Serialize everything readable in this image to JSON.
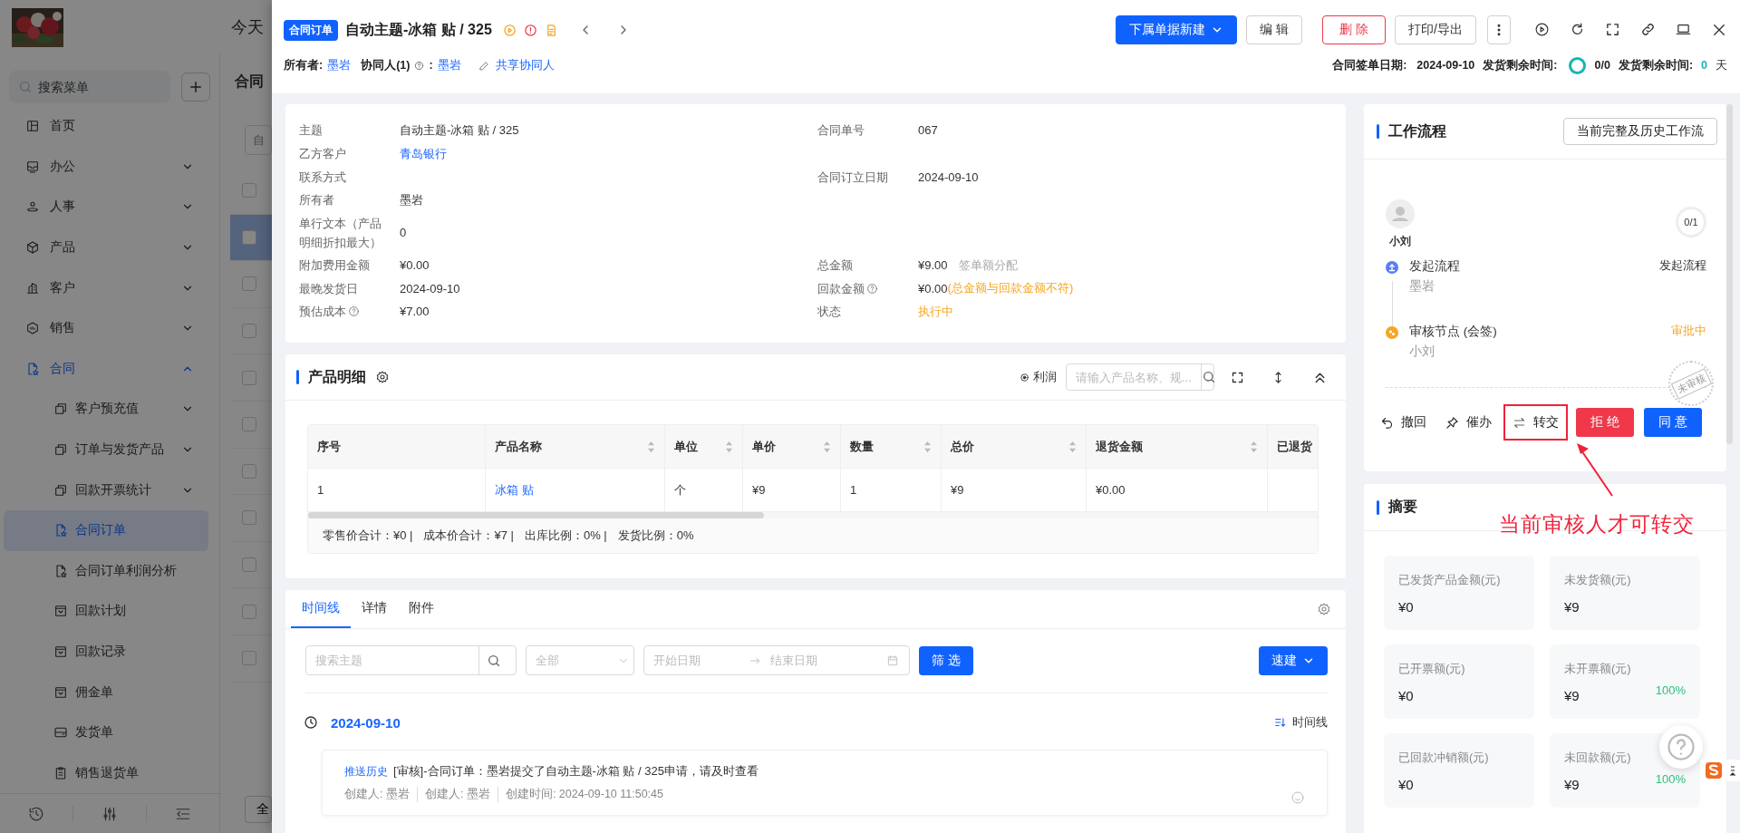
{
  "background_app": {
    "header_text": "今天",
    "sidebar": {
      "search_placeholder": "搜索菜单",
      "items": [
        {
          "label": "首页",
          "kind": "link",
          "selected": false
        },
        {
          "label": "办公",
          "kind": "group",
          "expanded": false,
          "selected": false
        },
        {
          "label": "人事",
          "kind": "group",
          "expanded": false,
          "selected": false
        },
        {
          "label": "产品",
          "kind": "group",
          "expanded": false,
          "selected": false
        },
        {
          "label": "客户",
          "kind": "group",
          "expanded": false,
          "selected": false
        },
        {
          "label": "销售",
          "kind": "group",
          "expanded": false,
          "selected": false
        },
        {
          "label": "合同",
          "kind": "group",
          "expanded": true,
          "selected": true,
          "children": [
            {
              "label": "客户预充值",
              "kind": "group",
              "expanded": false,
              "selected": false
            },
            {
              "label": "订单与发货产品",
              "kind": "group",
              "expanded": false,
              "selected": false
            },
            {
              "label": "回款开票统计",
              "kind": "group",
              "expanded": false,
              "selected": false
            },
            {
              "label": "合同订单",
              "kind": "link",
              "selected": true
            },
            {
              "label": "合同订单利润分析",
              "kind": "link",
              "selected": false
            },
            {
              "label": "回款计划",
              "kind": "link",
              "selected": false
            },
            {
              "label": "回款记录",
              "kind": "link",
              "selected": false
            },
            {
              "label": "佣金单",
              "kind": "link",
              "selected": false
            },
            {
              "label": "发货单",
              "kind": "link",
              "selected": false
            },
            {
              "label": "销售退货单",
              "kind": "link",
              "selected": false
            }
          ]
        }
      ]
    },
    "list": {
      "title": "合同",
      "filter_placeholder": "自",
      "rows": [
        {
          "checked": false,
          "selected": false
        },
        {
          "checked": false,
          "selected": true
        },
        {
          "checked": false,
          "selected": false
        },
        {
          "checked": false,
          "selected": false
        },
        {
          "checked": false,
          "selected": false
        },
        {
          "checked": false,
          "selected": false
        },
        {
          "checked": false,
          "selected": false
        },
        {
          "checked": false,
          "selected": false
        },
        {
          "checked": false,
          "selected": false
        },
        {
          "checked": false,
          "selected": false
        },
        {
          "checked": false,
          "selected": false
        }
      ],
      "footer_button": "全"
    }
  },
  "drawer": {
    "header": {
      "tag": "合同订单",
      "title": "自动主题-冰箱 贴 / 325",
      "actions": [
        {
          "label": "下属单据新建",
          "kind": "primary-dropdown"
        },
        {
          "label": "编 辑",
          "kind": "default"
        },
        {
          "label": "删 除",
          "kind": "danger"
        },
        {
          "label": "打印/导出",
          "kind": "default"
        }
      ],
      "owner": {
        "label": "所有者:",
        "value": "墨岩"
      },
      "collaborators": {
        "label": "协同人(1)",
        "separator": ":",
        "value": "墨岩"
      },
      "share_link": "共享协同人",
      "sign_date": {
        "label": "合同签单日期:",
        "value": "2024-09-10"
      },
      "delivery_progress": {
        "label": "发货剩余时间:",
        "value": "0/0"
      },
      "remaining": {
        "label": "发货剩余时间:",
        "value": "0",
        "unit": "天"
      }
    },
    "details": [
      {
        "left": {
          "label": "主题",
          "value": "自动主题-冰箱 贴 / 325",
          "kind": "text",
          "help": false
        },
        "right": {
          "label": "合同单号",
          "value": "067",
          "kind": "text",
          "help": false
        }
      },
      {
        "left": {
          "label": "乙方客户",
          "value": "青岛银行",
          "kind": "link",
          "help": false
        }
      },
      {
        "left": {
          "label": "联系方式",
          "kind": "text",
          "help": false
        },
        "right": {
          "label": "合同订立日期",
          "value": "2024-09-10",
          "kind": "text",
          "help": false
        }
      },
      {
        "left": {
          "label": "所有者",
          "value": "墨岩",
          "kind": "text",
          "help": false
        }
      },
      {
        "left": {
          "label": "单行文本（产品明细折扣最大）",
          "value": "0",
          "kind": "text",
          "help": false
        }
      },
      {
        "left": {
          "label": "附加费用金额",
          "value": "¥0.00",
          "kind": "text",
          "help": false
        },
        "right": {
          "label": "总金额",
          "value": "¥9.00",
          "kind": "text",
          "help": false,
          "note": "签单额分配"
        }
      },
      {
        "left": {
          "label": "最晚发货日",
          "value": "2024-09-10",
          "kind": "text",
          "help": false
        },
        "right": {
          "label": "回款金额",
          "value": "¥0.00",
          "kind": "text",
          "help": true,
          "warning": "(总金额与回款金额不符)"
        }
      },
      {
        "left": {
          "label": "预估成本",
          "value": "¥7.00",
          "kind": "text",
          "help": true
        },
        "right": {
          "label": "状态",
          "value": "执行中",
          "kind": "status",
          "help": false
        }
      }
    ],
    "products": {
      "title": "产品明细",
      "profit_label": "利润",
      "search_placeholder": "请输入产品名称、规...",
      "columns": [
        {
          "label": "序号",
          "sortable": false
        },
        {
          "label": "产品名称",
          "sortable": true,
          "kind": "link"
        },
        {
          "label": "单位",
          "sortable": true
        },
        {
          "label": "单价",
          "sortable": true
        },
        {
          "label": "数量",
          "sortable": true
        },
        {
          "label": "总价",
          "sortable": true
        },
        {
          "label": "退货金额",
          "sortable": true
        },
        {
          "label": "已退货",
          "sortable": false
        }
      ],
      "rows": [
        [
          "1",
          "冰箱 贴",
          "个",
          "¥9",
          "1",
          "¥9",
          "¥0.00"
        ]
      ],
      "totals": [
        "零售价合计：¥0 |",
        "成本价合计：¥7 |",
        "出库比例：0% |",
        "发货比例：0%"
      ]
    },
    "timeline": {
      "tabs": [
        {
          "label": "时间线",
          "selected": true
        },
        {
          "label": "详情",
          "selected": false
        },
        {
          "label": "附件",
          "selected": false
        }
      ],
      "search_placeholder": "搜索主题",
      "select_placeholder": "全部",
      "start_placeholder": "开始日期",
      "end_placeholder": "结束日期",
      "filter_button": "筛 选",
      "quick_button": "速建",
      "date": "2024-09-10",
      "view_label": "时间线",
      "entries": [
        {
          "tag": "推送历史",
          "text": "[审核]-合同订单：墨岩提交了自动主题-冰箱 贴 / 325申请，请及时查看",
          "meta": [
            "创建人: 墨岩",
            "创建人: 墨岩",
            "创建时间: 2024-09-10 11:50:45"
          ]
        }
      ]
    },
    "workflow": {
      "title": "工作流程",
      "history_button": "当前完整及历史工作流",
      "approver": "小刘",
      "progress": "0/1",
      "steps": [
        {
          "kind": "start",
          "title": "发起流程",
          "person": "墨岩",
          "status": "发起流程"
        },
        {
          "kind": "review",
          "title": "审核节点 (会签)",
          "person": "小刘",
          "status": "审批中"
        }
      ],
      "stamp": "未审核",
      "actions": [
        {
          "kind": "undo",
          "label": "撤回",
          "highlighted": false
        },
        {
          "kind": "urge",
          "label": "催办",
          "highlighted": false
        },
        {
          "kind": "transfer",
          "label": "转交",
          "highlighted": true
        },
        {
          "kind": "reject",
          "label": "拒 绝",
          "highlighted": false
        },
        {
          "kind": "approve",
          "label": "同 意",
          "highlighted": false
        }
      ]
    },
    "annotation": {
      "text": "当前审核人才可转交"
    },
    "summary": {
      "title": "摘要",
      "tiles": [
        {
          "label": "已发货产品金额(元)",
          "value": "¥0"
        },
        {
          "label": "未发货额(元)",
          "value": "¥9"
        },
        {
          "label": "已开票额(元)",
          "value": "¥0"
        },
        {
          "label": "未开票额(元)",
          "value": "¥9",
          "percent": "100%"
        },
        {
          "label": "已回款冲销额(元)",
          "value": "¥0"
        },
        {
          "label": "未回款额(元)",
          "value": "¥9",
          "percent": "100%"
        }
      ]
    }
  }
}
